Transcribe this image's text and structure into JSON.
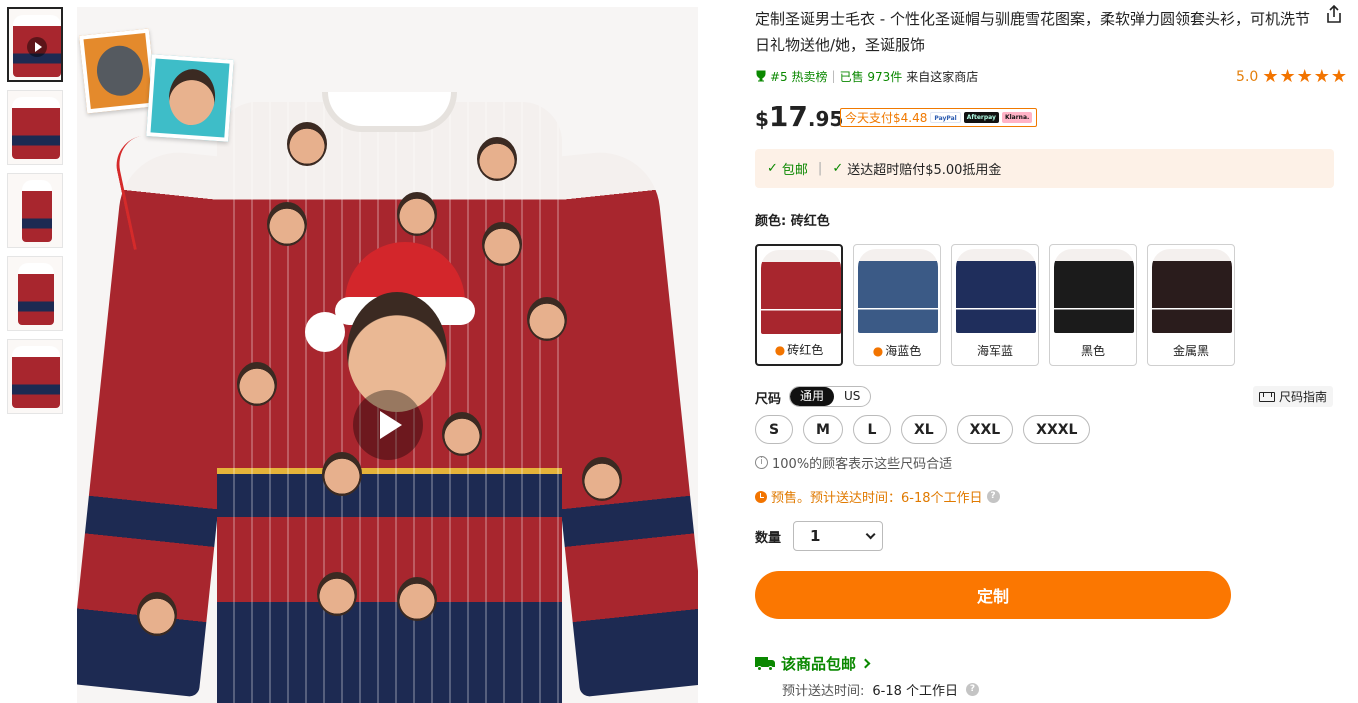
{
  "gallery": {
    "thumb_count": 5,
    "active_thumb": 0,
    "main_has_video": true
  },
  "product": {
    "title": "定制圣诞男士毛衣 - 个性化圣诞帽与驯鹿雪花图案，柔软弹力圆领套头衫，可机洗节日礼物送他/她，圣诞服饰",
    "rank_badge": "#5 热卖榜",
    "sold": "已售 973件",
    "from_store": "来自这家商店",
    "rating": "5.0",
    "stars": "★★★★★",
    "price_currency": "$",
    "price_int": "17",
    "price_dec": ".95",
    "pay_today": "今天支付$4.48",
    "pay_logos": [
      "PayPal",
      "Afterpay",
      "Klarna."
    ]
  },
  "shipping_box": {
    "free_shipping": "包邮",
    "late_credit": "送达超时赔付$5.00抵用金"
  },
  "color": {
    "label": "颜色: 砖红色",
    "options": [
      {
        "name": "砖红色",
        "hot": true,
        "color": "#a8262e",
        "selected": true
      },
      {
        "name": "海蓝色",
        "hot": true,
        "color": "#3b5a86",
        "selected": false
      },
      {
        "name": "海军蓝",
        "hot": false,
        "color": "#1f2e5c",
        "selected": false
      },
      {
        "name": "黑色",
        "hot": false,
        "color": "#1b1b1b",
        "selected": false
      },
      {
        "name": "金属黑",
        "hot": false,
        "color": "#2a1c1c",
        "selected": false
      }
    ]
  },
  "size": {
    "label": "尺码",
    "toggle": [
      "通用",
      "US"
    ],
    "guide": "尺码指南",
    "options": [
      "S",
      "M",
      "L",
      "XL",
      "XXL",
      "XXXL"
    ],
    "fit_note": "100%的顾客表示这些尺码合适",
    "presale": "预售。预计送达时间：6-18个工作日"
  },
  "quantity": {
    "label": "数量",
    "value": "1"
  },
  "cta": {
    "customize": "定制"
  },
  "delivery": {
    "free_shipping_link": "该商品包邮",
    "eta_label": "预计送达时间:",
    "eta_value": "6-18 个工作日"
  }
}
